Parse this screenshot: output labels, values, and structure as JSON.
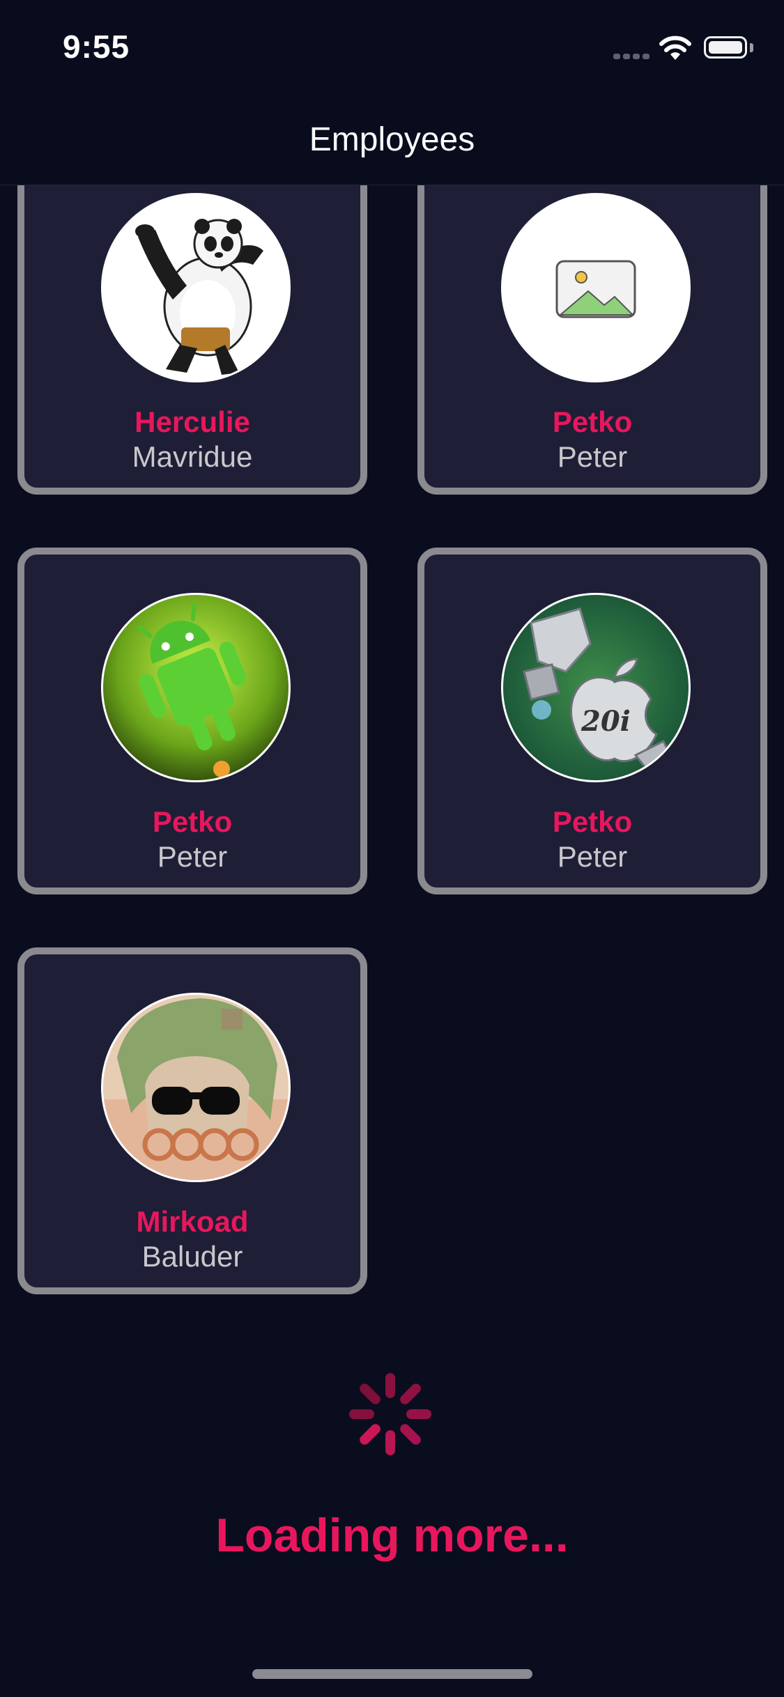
{
  "status": {
    "time": "9:55"
  },
  "nav": {
    "title": "Employees"
  },
  "employees": [
    {
      "first": "Herculie",
      "last": "Mavridue",
      "avatar": "panda-avatar"
    },
    {
      "first": "Petko",
      "last": "Peter",
      "avatar": "image-placeholder-icon"
    },
    {
      "first": "Petko",
      "last": "Peter",
      "avatar": "android-avatar"
    },
    {
      "first": "Petko",
      "last": "Peter",
      "avatar": "apple-robot-avatar"
    },
    {
      "first": "Mirkoad",
      "last": "Baluder",
      "avatar": "person-sunglasses-avatar"
    }
  ],
  "footer": {
    "loading_text": "Loading more..."
  },
  "colors": {
    "accent": "#e8175d",
    "background": "#0a0d1e",
    "card": "#1e1e36",
    "card_border": "#8a8a90"
  }
}
